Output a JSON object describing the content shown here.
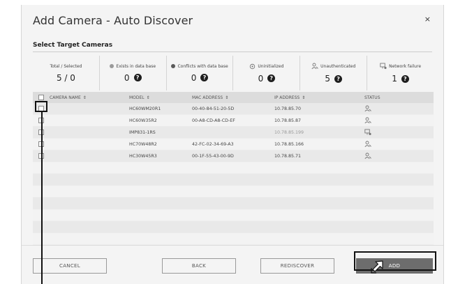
{
  "dialog": {
    "title": "Add Camera - Auto Discover",
    "close_label": "×"
  },
  "section": {
    "title": "Select Target Cameras"
  },
  "stats": [
    {
      "label": "Total / Selected",
      "value": "5 / 0",
      "icon": "none",
      "help": false
    },
    {
      "label": "Exists in data base",
      "value": "0",
      "icon": "grey-dot-icon",
      "help": true
    },
    {
      "label": "Conflicts with data base",
      "value": "0",
      "icon": "dark-dot-icon",
      "help": true
    },
    {
      "label": "Uninitialized",
      "value": "0",
      "icon": "uninitialized-icon",
      "help": true
    },
    {
      "label": "Unauthenticated",
      "value": "5",
      "icon": "unauthenticated-user-icon",
      "help": true
    },
    {
      "label": "Network failure",
      "value": "1",
      "icon": "network-failure-icon",
      "help": true
    }
  ],
  "help_glyph": "?",
  "table": {
    "columns": {
      "camera_name": "CAMERA NAME",
      "model": "MODEL",
      "mac": "MAC ADDRESS",
      "ip": "IP ADDRESS",
      "status": "STATUS"
    },
    "rows": [
      {
        "camera_name": "",
        "model": "HC60WM20R1",
        "mac": "00-40-84-51-20-5D",
        "ip": "10.78.85.70",
        "status": "unauthenticated-user-icon"
      },
      {
        "camera_name": "",
        "model": "HC60W35R2",
        "mac": "00-A8-CD-A8-CD-EF",
        "ip": "10.78.85.87",
        "status": "unauthenticated-user-icon"
      },
      {
        "camera_name": "",
        "model": "IMP831-1RS",
        "mac": "",
        "ip": "10.78.85.199",
        "status": "network-failure-icon"
      },
      {
        "camera_name": "",
        "model": "HC70W48R2",
        "mac": "42-FC-02-34-69-A3",
        "ip": "10.78.85.166",
        "status": "unauthenticated-user-icon"
      },
      {
        "camera_name": "",
        "model": "HC30W45R3",
        "mac": "00-1F-55-43-00-9D",
        "ip": "10.78.85.71",
        "status": "unauthenticated-user-icon"
      }
    ],
    "empty_rows": 7
  },
  "buttons": {
    "cancel": "CANCEL",
    "back": "BACK",
    "rediscover": "REDISCOVER",
    "add": "ADD"
  }
}
